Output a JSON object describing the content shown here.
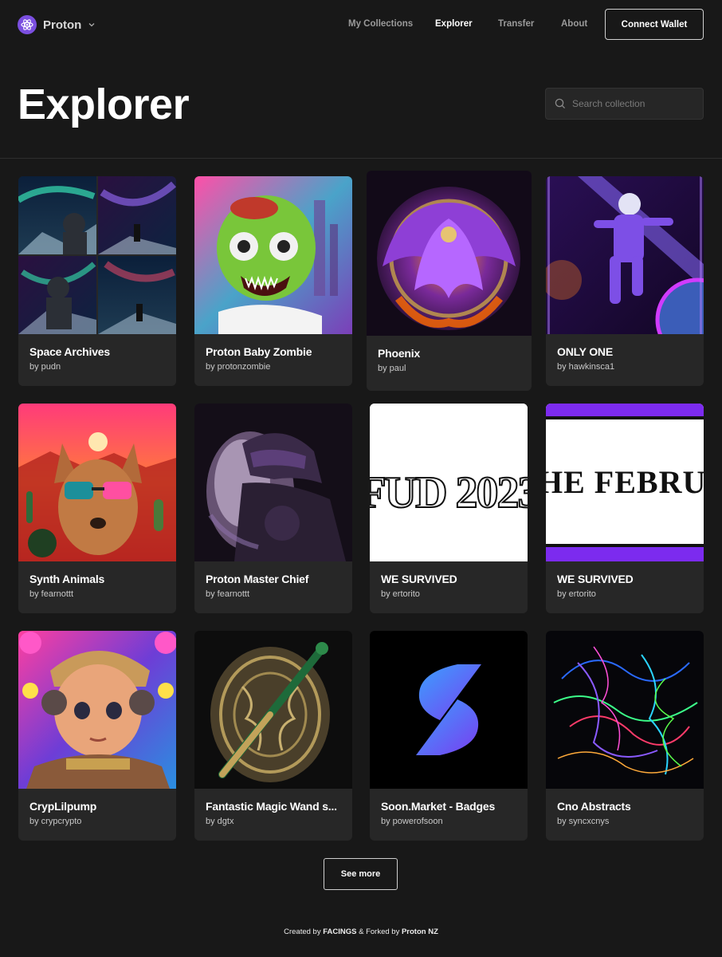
{
  "brand": {
    "name": "Proton",
    "logo_icon": "atom-icon",
    "accent": "#7b4fe0"
  },
  "nav": {
    "items": [
      {
        "label": "My Collections",
        "active": false
      },
      {
        "label": "Explorer",
        "active": true
      },
      {
        "label": "Transfer",
        "active": false
      },
      {
        "label": "About",
        "active": false
      }
    ],
    "connect_label": "Connect Wallet"
  },
  "page": {
    "title": "Explorer"
  },
  "search": {
    "placeholder": "Search collection",
    "icon": "search-icon"
  },
  "collections": [
    {
      "title": "Space Archives",
      "owner": "by pudn"
    },
    {
      "title": "Proton Baby Zombie",
      "owner": "by protonzombie"
    },
    {
      "title": "Phoenix",
      "owner": "by paul"
    },
    {
      "title": "ONLY ONE",
      "owner": "by hawkinsca1"
    },
    {
      "title": "Synth Animals",
      "owner": "by fearnottt"
    },
    {
      "title": "Proton Master Chief",
      "owner": "by fearnottt"
    },
    {
      "title": "WE SURVIVED",
      "owner": "by ertorito",
      "image_text": "FUD 2023"
    },
    {
      "title": "WE SURVIVED",
      "owner": "by ertorito",
      "image_text": "HE FEBRU"
    },
    {
      "title": "CrypLilpump",
      "owner": "by crypcrypto"
    },
    {
      "title": "Fantastic Magic Wand s...",
      "owner": "by dgtx"
    },
    {
      "title": "Soon.Market - Badges",
      "owner": "by powerofsoon"
    },
    {
      "title": "Cno Abstracts",
      "owner": "by syncxcnys"
    }
  ],
  "see_more_label": "See more",
  "footer": {
    "prefix": "Created by ",
    "facings": "FACINGS",
    "middle": " & Forked by ",
    "proton_nz": "Proton NZ"
  }
}
